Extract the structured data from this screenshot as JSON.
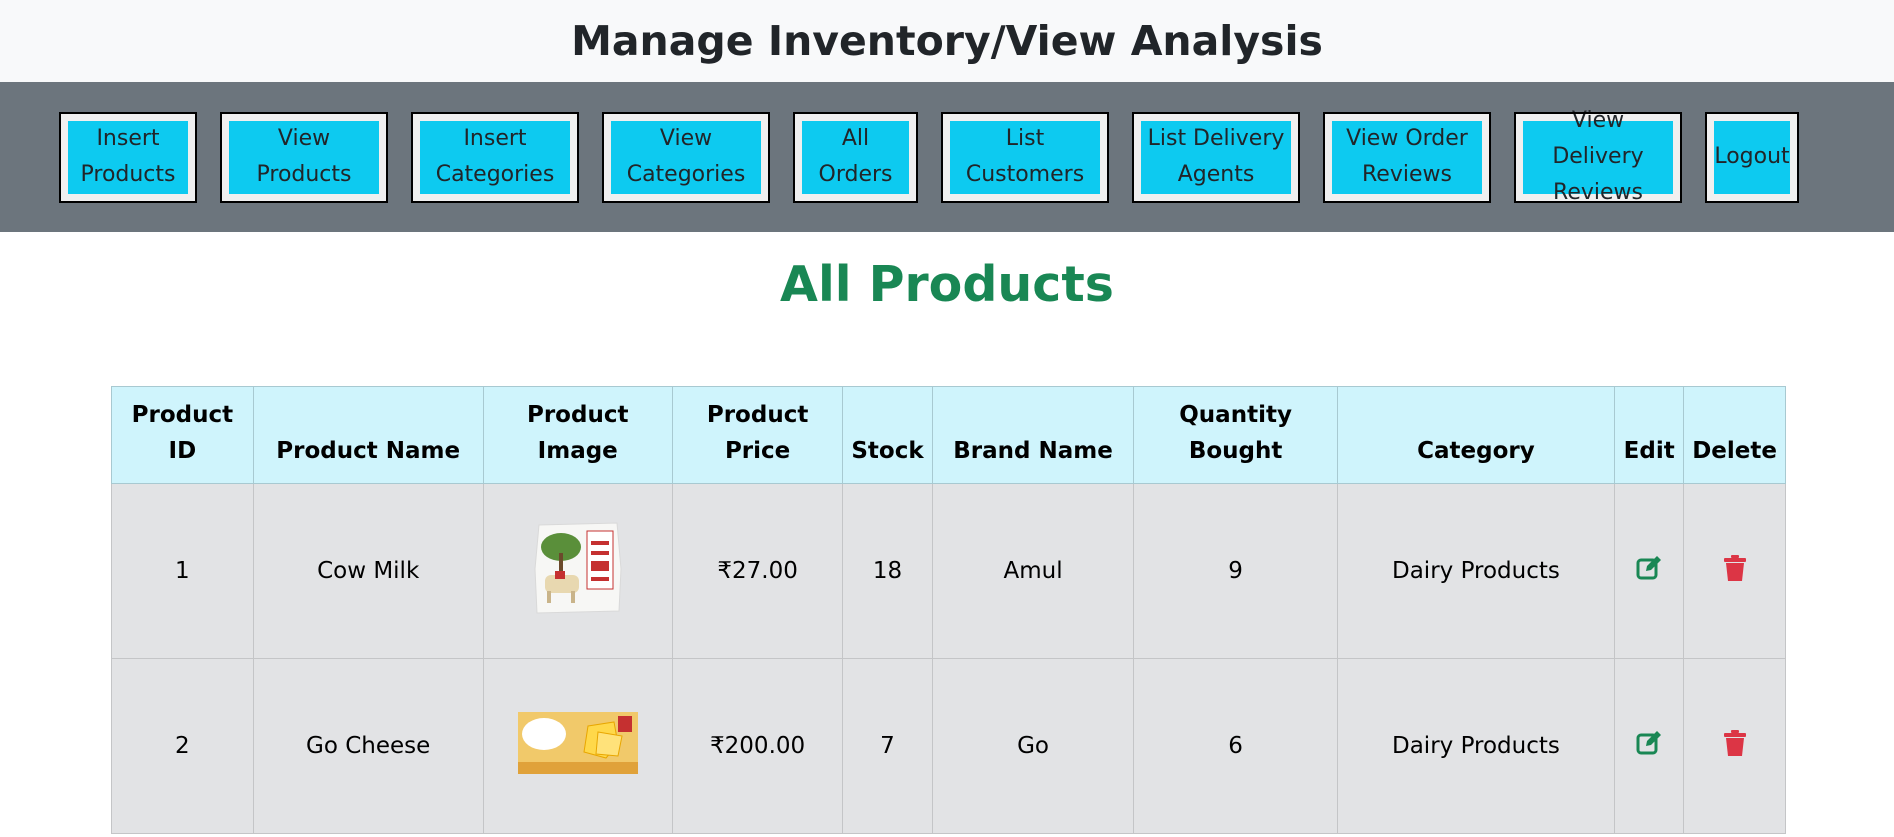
{
  "header": {
    "title": "Manage Inventory/View Analysis"
  },
  "nav": [
    {
      "label_line1": "Insert",
      "label_line2": "Products"
    },
    {
      "label_line1": "View",
      "label_line2": "Products"
    },
    {
      "label_line1": "Insert",
      "label_line2": "Categories"
    },
    {
      "label_line1": "View",
      "label_line2": "Categories"
    },
    {
      "label_line1": "All Orders",
      "label_line2": ""
    },
    {
      "label_line1": "List",
      "label_line2": "Customers"
    },
    {
      "label_line1": "List Delivery",
      "label_line2": "Agents"
    },
    {
      "label_line1": "View Order",
      "label_line2": "Reviews"
    },
    {
      "label_line1": "View Delivery",
      "label_line2": "Reviews"
    },
    {
      "label_line1": "Logout",
      "label_line2": ""
    }
  ],
  "section": {
    "title": "All Products"
  },
  "table": {
    "headers": {
      "product_id_1": "Product",
      "product_id_2": "ID",
      "product_name": "Product Name",
      "product_image_1": "Product",
      "product_image_2": "Image",
      "product_price_1": "Product",
      "product_price_2": "Price",
      "stock": "Stock",
      "brand_name": "Brand Name",
      "quantity_bought_1": "Quantity",
      "quantity_bought_2": "Bought",
      "category": "Category",
      "edit": "Edit",
      "delete": "Delete"
    },
    "rows": [
      {
        "id": "1",
        "name": "Cow Milk",
        "image_icon": "milk-packet",
        "price": "₹27.00",
        "stock": "18",
        "brand": "Amul",
        "quantity": "9",
        "category": "Dairy Products"
      },
      {
        "id": "2",
        "name": "Go Cheese",
        "image_icon": "cheese-pack",
        "price": "₹200.00",
        "stock": "7",
        "brand": "Go",
        "quantity": "6",
        "category": "Dairy Products"
      }
    ]
  },
  "colors": {
    "nav_bg": "#6c757d",
    "nav_button": "#0dcaf0",
    "section_title": "#198754",
    "header_bg": "#cff4fc",
    "row_bg": "#e2e3e5",
    "edit_icon": "#198754",
    "delete_icon": "#dc3545"
  }
}
